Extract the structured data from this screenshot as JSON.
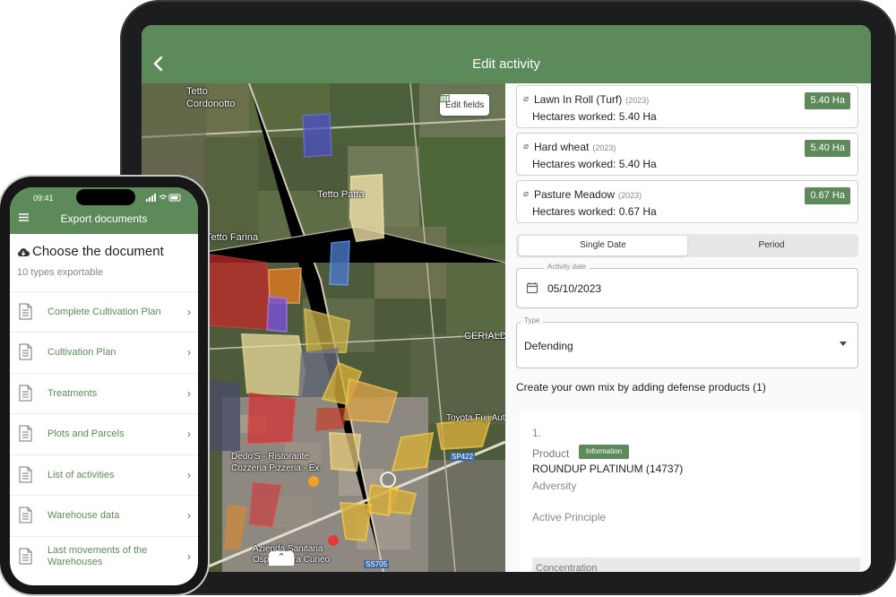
{
  "colors": {
    "brand": "#5d8a5a",
    "background": "#ffffff",
    "badge": "#5d8a5a"
  },
  "tablet": {
    "header": {
      "title": "Edit activity",
      "back_icon": "chevron-left-icon"
    },
    "map": {
      "edit_fields_label": "Edit fields",
      "places": [
        {
          "name": "Tetto\nCordonotto"
        },
        {
          "name": "Tetto Patta"
        },
        {
          "name": "Tetto Farina"
        },
        {
          "name": "CERIALD"
        },
        {
          "name": "Toyota Fuji Aut"
        },
        {
          "name": "Dedo'S - Ristorante\nCozzeria Pizzeria - Ex."
        },
        {
          "name": "Azienda Sanitaria\nOspedaliera Cuneo"
        },
        {
          "name": "SP422"
        },
        {
          "name": "SS705"
        }
      ]
    },
    "crops": [
      {
        "name": "Lawn In Roll (Turf)",
        "year": "(2023)",
        "worked": "Hectares worked: 5.40 Ha",
        "badge": "5.40 Ha"
      },
      {
        "name": "Hard wheat",
        "year": "(2023)",
        "worked": "Hectares worked: 5.40 Ha",
        "badge": "5.40 Ha"
      },
      {
        "name": "Pasture Meadow",
        "year": "(2023)",
        "worked": "Hectares worked: 0.67 Ha",
        "badge": "0.67 Ha"
      }
    ],
    "date_mode": {
      "options": [
        "Single Date",
        "Period"
      ],
      "selected": "Single Date"
    },
    "activity_date": {
      "label": "Activity date",
      "value": "05/10/2023"
    },
    "type": {
      "label": "Type",
      "value": "Defending"
    },
    "mix_title": "Create your own mix by adding defense products (1)",
    "product": {
      "number": "1.",
      "product_label": "Product",
      "info_badge": "Information",
      "name": "ROUNDUP PLATINUM (14737)",
      "adversity_label": "Adversity",
      "active_principle_label": "Active Principle",
      "concentration_label": "Concentration"
    }
  },
  "phone": {
    "status": {
      "time": "09:41"
    },
    "header": {
      "title": "Export documents"
    },
    "choose_title": "Choose the document",
    "types_count": "10 types exportable",
    "documents": [
      {
        "label": "Complete Cultivation Plan"
      },
      {
        "label": "Cultivation Plan"
      },
      {
        "label": "Treatments"
      },
      {
        "label": "Plots and Parcels"
      },
      {
        "label": "List of activities"
      },
      {
        "label": "Warehouse data"
      },
      {
        "label": "Last movements of the Warehouses"
      }
    ]
  }
}
